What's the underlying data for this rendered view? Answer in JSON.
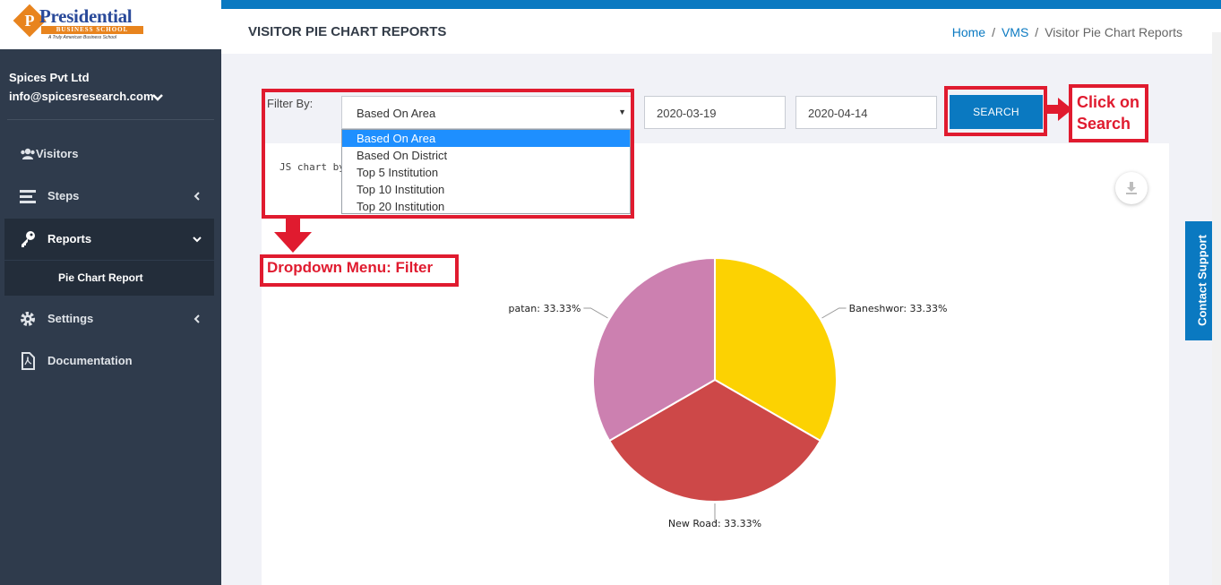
{
  "brand": {
    "logo_letter": "P",
    "logo_title": "Presidential",
    "logo_band": "BUSINESS SCHOOL",
    "logo_tagline": "A Truly American Business School"
  },
  "user": {
    "company": "Spices Pvt Ltd",
    "email": "info@spicesresearch.com"
  },
  "sidebar": {
    "items": [
      {
        "label": "Visitors",
        "icon": "users-icon"
      },
      {
        "label": "Steps",
        "icon": "list-icon"
      },
      {
        "label": "Reports",
        "icon": "key-icon"
      },
      {
        "label": "Settings",
        "icon": "gear-icon"
      },
      {
        "label": "Documentation",
        "icon": "pdf-file-icon"
      }
    ],
    "sub_item": "Pie Chart Report"
  },
  "header": {
    "title": "VISITOR PIE CHART REPORTS",
    "breadcrumb": [
      "Home",
      "VMS",
      "Visitor Pie Chart Reports"
    ],
    "separator": "/"
  },
  "filter": {
    "label": "Filter By:",
    "selected": "Based On Area",
    "options": [
      "Based On Area",
      "Based On District",
      "Top 5 Institution",
      "Top 10 Institution",
      "Top 20 Institution"
    ],
    "date_from": "2020-03-19",
    "date_to": "2020-04-14",
    "search_label": "SEARCH"
  },
  "annotations": {
    "click_line1": "Click on",
    "click_line2": "Search",
    "dropdown_label": "Dropdown Menu: Filter"
  },
  "chart": {
    "credit": "JS chart by a"
  },
  "chart_data": {
    "type": "pie",
    "slices": [
      {
        "label": "Baneshwor",
        "value": 33.33,
        "display": "Baneshwor: 33.33%",
        "color": "#fcd202"
      },
      {
        "label": "New Road",
        "value": 33.33,
        "display": "New Road: 33.33%",
        "color": "#cd4848"
      },
      {
        "label": "patan",
        "value": 33.33,
        "display": "patan: 33.33%",
        "color": "#cc80b0"
      }
    ]
  },
  "contact_support": "Contact Support",
  "colors": {
    "sidebar": "#2f3b4c",
    "accent": "#0a79c1",
    "annotation_red": "#e01b2f"
  }
}
